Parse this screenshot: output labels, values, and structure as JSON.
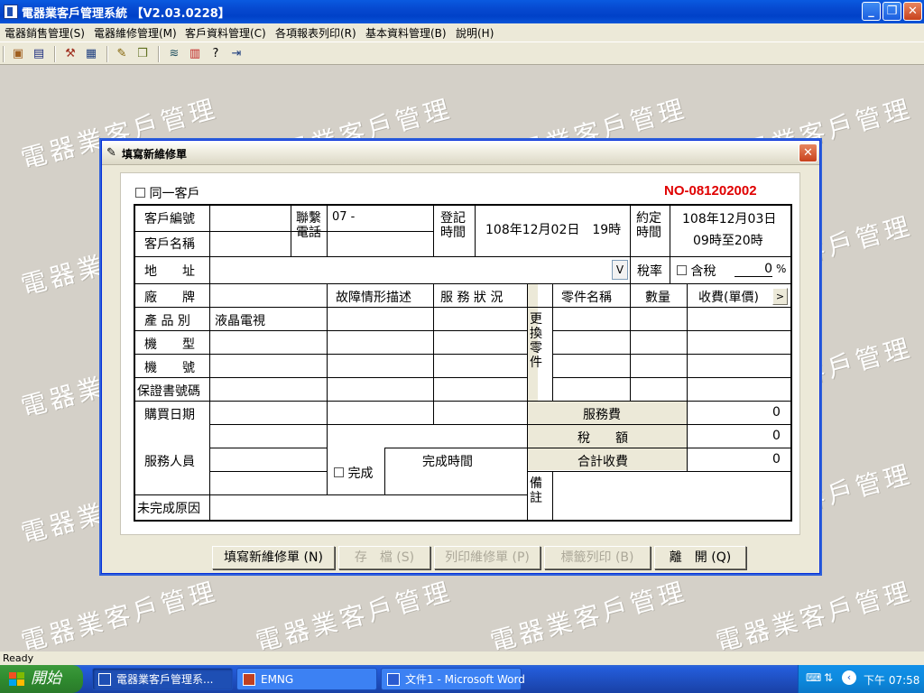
{
  "app": {
    "title": "電器業客戶管理系統 【V2.03.0228】",
    "status_text": "Ready"
  },
  "menu": [
    {
      "label": "電器銷售管理(S)"
    },
    {
      "label": "電器維修管理(M)"
    },
    {
      "label": "客戶資料管理(C)"
    },
    {
      "label": "各項報表列印(R)"
    },
    {
      "label": "基本資料管理(B)"
    },
    {
      "label": "說明(H)"
    }
  ],
  "watermark": "電器業客戶管理",
  "dialog": {
    "title": "填寫新維修單",
    "same_customer_label": "同一客戶",
    "order_no": "NO-081202002",
    "labels": {
      "customer_id": "客戶編號",
      "customer_name": "客戶名稱",
      "contact_phone": "聯繫電話",
      "register_time": "登記時間",
      "appointment_time": "約定時間",
      "address": "地　　址",
      "tax_rate": "稅率",
      "tax_included": "含稅",
      "percent": "%",
      "brand": "廠　　牌",
      "product_type": "產 品 別",
      "model": "機　　型",
      "serial_no": "機　　號",
      "warranty_no": "保證書號碼",
      "purchase_date": "購買日期",
      "service_staff": "服務人員",
      "incomplete_reason": "未完成原因",
      "fault_desc": "故障情形描述",
      "service_status": "服 務 狀 況",
      "replaced_parts": "更換零件",
      "part_name": "零件名稱",
      "quantity": "數量",
      "charge_unit": "收費(單價)",
      "service_fee": "服務費",
      "tax_amount": "稅　　額",
      "total_charge": "合計收費",
      "complete": "完成",
      "complete_time": "完成時間",
      "remarks": "備註"
    },
    "values": {
      "phone_prefix": "07 -",
      "register_time": "108年12月02日　19時",
      "appointment_date": "108年12月03日",
      "appointment_hours": "09時至20時",
      "tax_rate": "0",
      "product_type": "液晶電視",
      "service_fee": "0",
      "tax_amount": "0",
      "total_charge": "0",
      "dropdown_glyph": "V",
      "more_glyph": ">"
    },
    "buttons": {
      "new_order": "填寫新維修單 (N)",
      "save": "存　檔 (S)",
      "print_order": "列印維修單 (P)",
      "print_label": "標籤列印 (B)",
      "exit": "離　開 (Q)"
    }
  },
  "taskbar": {
    "start_label": "開始",
    "tasks": [
      {
        "label": "電器業客戶管理系..."
      },
      {
        "label": "EMNG"
      },
      {
        "label": "文件1 - Microsoft Word"
      }
    ],
    "clock": "下午 07:58"
  },
  "colors": {
    "order_no": "#e00000",
    "titlebar": "#0a5ae0",
    "taskbar": "#245ddb",
    "start": "#2f8b2f"
  }
}
